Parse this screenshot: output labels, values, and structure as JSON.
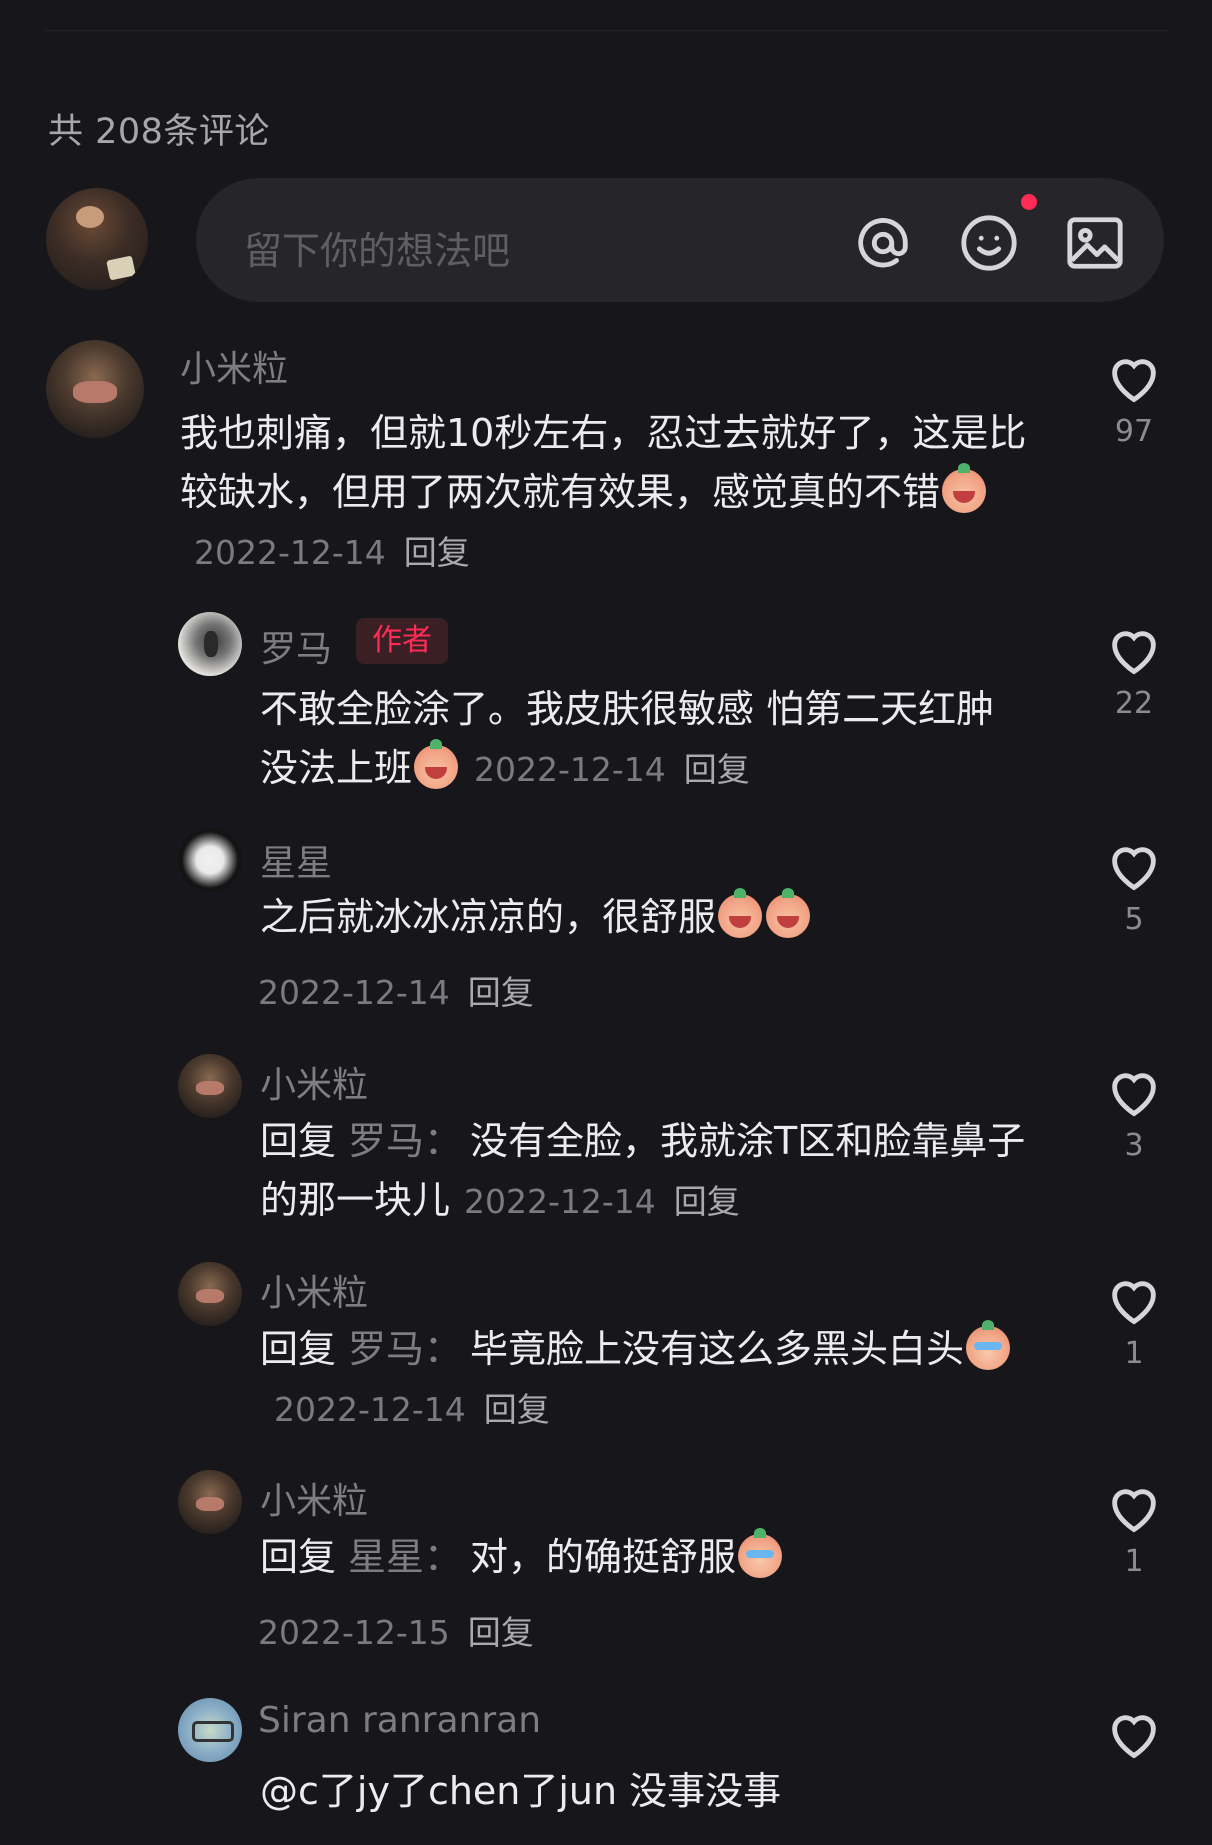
{
  "header": {
    "count_label": "共 208条评论"
  },
  "composer": {
    "placeholder": "留下你的想法吧",
    "icons": [
      "at-icon",
      "emoji-icon",
      "image-icon"
    ],
    "has_notification_dot": true
  },
  "comments": [
    {
      "user": "小米粒",
      "text": "我也刺痛，但就10秒左右，忍过去就好了，这是比较缺水，但用了两次就有效果，感觉真的不错",
      "emoji": "smile-emoji",
      "date": "2022-12-14",
      "reply_label": "回复",
      "likes": "97"
    },
    {
      "user": "罗马",
      "tag": "作者",
      "text": "不敢全脸涂了。我皮肤很敏感 怕第二天红肿没法上班",
      "emoji": "smile-emoji",
      "date": "2022-12-14",
      "reply_label": "回复",
      "likes": "22"
    },
    {
      "user": "星星",
      "text": "之后就冰冰凉凉的，很舒服",
      "emoji": "laugh-emoji",
      "date": "2022-12-14",
      "reply_label": "回复",
      "likes": "5"
    },
    {
      "user": "小米粒",
      "prefix": "回复",
      "reply_to": "罗马：",
      "text": "没有全脸，我就涂T区和脸靠鼻子的那一块儿",
      "date": "2022-12-14",
      "reply_label": "回复",
      "likes": "3"
    },
    {
      "user": "小米粒",
      "prefix": "回复",
      "reply_to": "罗马：",
      "text": "毕竟脸上没有这么多黑头白头",
      "emoji": "cry-emoji",
      "date": "2022-12-14",
      "reply_label": "回复",
      "likes": "1"
    },
    {
      "user": "小米粒",
      "prefix": "回复",
      "reply_to": "星星：",
      "text": "对，的确挺舒服",
      "emoji": "cry-emoji",
      "date": "2022-12-15",
      "reply_label": "回复",
      "likes": "1"
    },
    {
      "user": "Siran ranranran",
      "text": "@c了jy了chen了jun  没事没事",
      "likes": ""
    }
  ],
  "colors": {
    "background": "#17171b",
    "author_tag": "#fe2c55",
    "notification_dot": "#fe2c55"
  }
}
